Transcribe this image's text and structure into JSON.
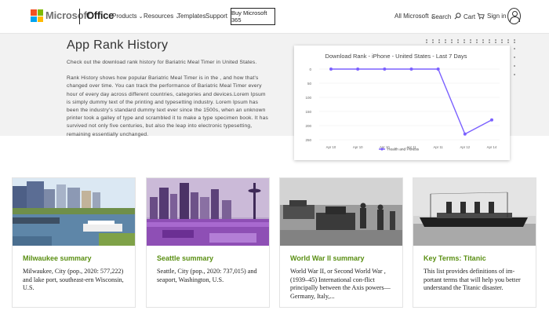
{
  "header": {
    "brand": "Microsoft",
    "product": "Office",
    "nav": [
      {
        "label": "Products",
        "has_menu": true
      },
      {
        "label": "Resources",
        "has_menu": true
      },
      {
        "label": "Templates",
        "has_menu": false
      },
      {
        "label": "Support",
        "has_menu": false
      }
    ],
    "buy_label": "Buy Microsoft 365",
    "all_microsoft": "All Microsoft",
    "search_label": "Search",
    "cart_label": "Cart",
    "signin_label": "Sign in",
    "logo_colors": [
      "#f25022",
      "#7fba00",
      "#00a4ef",
      "#ffb900"
    ]
  },
  "hero": {
    "title": "App Rank History",
    "intro": "Check out the download rank history for Bariatric Meal Timer in United States.",
    "body": "Rank History shows how popular Bariatric Meal Timer is in the , and how that's changed over time. You can track the performance of Bariatric Meal Timer every hour of every day across different countries, categories and devices.Lorem Ipsum is simply dummy text of the printing and typesetting industry. Lorem Ipsum has been the industry's standard dummy text ever since the 1500s, when an unknown printer took a galley of type and scrambled it to make a type specimen book. It has survived not only five centuries, but also the leap into electronic typesetting, remaining essentially unchanged."
  },
  "chart_data": {
    "type": "line",
    "title": "Download Rank - iPhone - United States - Last 7 Days",
    "categories": [
      "Apr 10",
      "Apr 10",
      "Apr 10",
      "Apr 11",
      "Apr 11",
      "Apr 12",
      "Apr 14"
    ],
    "series": [
      {
        "name": "Health and Fitness",
        "values": [
          0,
          0,
          0,
          0,
          0,
          230,
          180
        ],
        "color": "#7b61ff"
      }
    ],
    "y_ticks": [
      "0",
      "50",
      "100",
      "150",
      "200",
      "250"
    ],
    "ylim": [
      0,
      250
    ],
    "y_inverted": true,
    "grid": true,
    "legend": "bottom"
  },
  "cards": [
    {
      "title": "Milwaukee summary",
      "desc": "Milwaukee, City (pop., 2020: 577,222) and lake port, southeast-ern Wisconsin, U.S."
    },
    {
      "title": "Seattle summary",
      "desc": "Seattle, City (pop., 2020: 737,015) and seaport, Washington, U.S."
    },
    {
      "title": "World War II summary",
      "desc": "World War II, or Second World War , (1939–45) International con-flict principally between the Axis powers—Germany, Italy,..."
    },
    {
      "title": "Key Terms: Titanic",
      "desc": "This list provides definitions of im-portant terms that will help you better understand the Titanic disaster."
    }
  ]
}
